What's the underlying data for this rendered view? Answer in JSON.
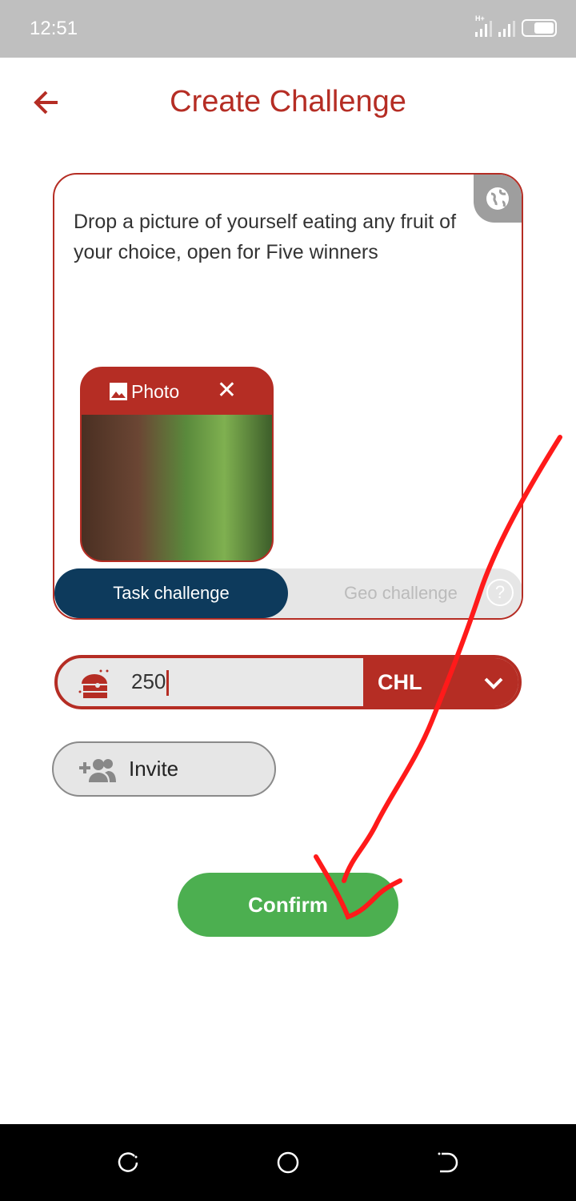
{
  "status_bar": {
    "time": "12:51",
    "network": "H+"
  },
  "header": {
    "title": "Create Challenge",
    "back_icon": "arrow-left-icon"
  },
  "challenge": {
    "description": "Drop a picture of yourself eating any fruit of your choice, open for Five winners",
    "visibility_icon": "globe-icon",
    "attachment": {
      "label": "Photo",
      "icon": "image-icon",
      "remove_icon": "close-icon"
    },
    "types": {
      "active": "Task challenge",
      "inactive": "Geo challenge",
      "help": "?"
    }
  },
  "amount": {
    "value": "250",
    "currency": "CHL",
    "icon": "treasure-chest-icon"
  },
  "invite": {
    "label": "Invite",
    "icon": "add-group-icon"
  },
  "confirm": {
    "label": "Confirm"
  },
  "colors": {
    "brand": "#b52d24",
    "navy": "#0d3a5c",
    "confirm": "#4caf50",
    "annotation": "#ff1a1a"
  }
}
